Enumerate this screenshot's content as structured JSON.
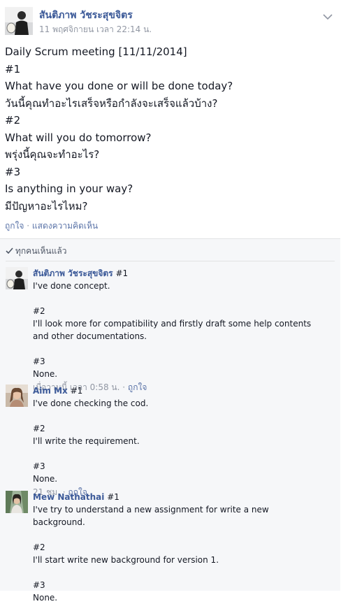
{
  "post": {
    "author": "สันติภาพ วัชระสุขจิตร",
    "timestamp": "11 พฤศจิกายน เวลา 22:14 น.",
    "lines": [
      "Daily Scrum meeting [11/11/2014]",
      "#1",
      "What have you done or will be done today?",
      "วันนี้คุณทำอะไรเสร็จหรือกำลังจะเสร็จแล้วบ้าง?",
      "#2",
      "What will you do tomorrow?",
      "พรุ่งนี้คุณจะทำอะไร?",
      "#3",
      "Is anything in your way?",
      "มีปัญหาอะไรไหม?"
    ],
    "actions": {
      "like": "ถูกใจ",
      "comment": "แสดงความคิดเห็น"
    }
  },
  "seen": {
    "label": "ทุกคนเห็นแล้ว"
  },
  "comments": [
    {
      "author": "สันติภาพ วัชระสุขจิตร",
      "first_line": "#1",
      "paragraphs": [
        [
          "I've done concept."
        ],
        [
          "#2",
          "I'll look more for compatibility and firstly draft some help contents",
          "and other documentations."
        ],
        [
          "#3",
          "None."
        ]
      ],
      "time": "เมื่อวานนี้ เวลา 0:58 น.",
      "like": "ถูกใจ"
    },
    {
      "author": "Aim Mx",
      "first_line": "#1",
      "paragraphs": [
        [
          "I've done checking the cod."
        ],
        [
          "#2",
          "I'll write the requirement."
        ],
        [
          "#3",
          "None."
        ]
      ],
      "time": "21 ชม.",
      "like": "ถูกใจ"
    },
    {
      "author": "Mew Nathathai",
      "first_line": "#1",
      "paragraphs": [
        [
          "I've try to understand a new assignment for write a new",
          "background."
        ],
        [
          "#2",
          "I'll start write new background for version 1."
        ],
        [
          "#3",
          "None."
        ]
      ]
    }
  ],
  "colors": {
    "link": "#3b5998",
    "meta": "#9197a3",
    "comments_bg": "#f6f7f9"
  },
  "icons": {
    "menu": "chevron-down-icon",
    "seen": "check-icon"
  }
}
